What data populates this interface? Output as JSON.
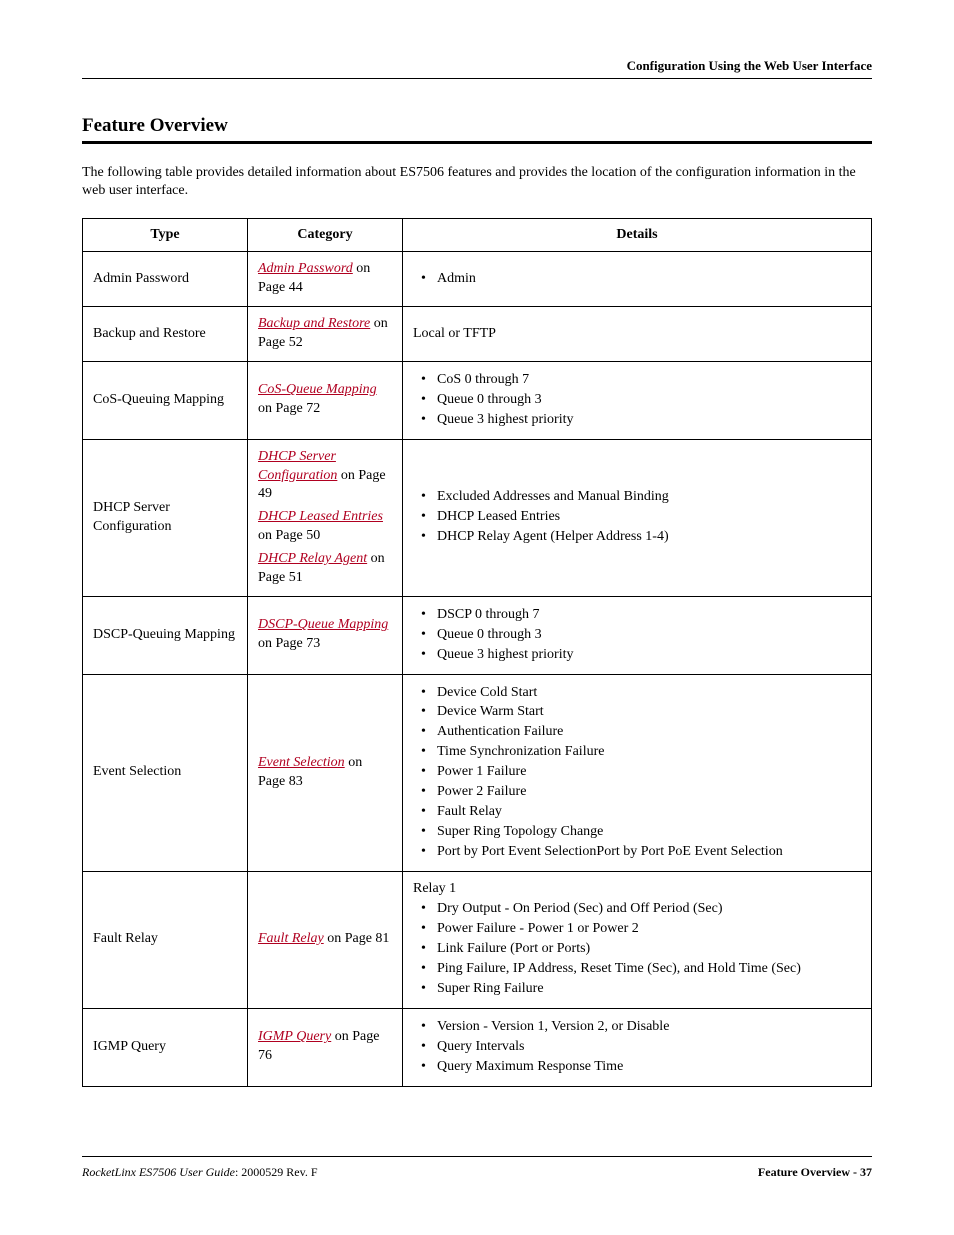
{
  "header": {
    "right": "Configuration Using the Web User Interface"
  },
  "section": {
    "title": "Feature Overview",
    "intro": "The following table provides detailed information about ES7506 features and provides the location of the configuration information in the web user interface."
  },
  "table": {
    "headers": {
      "type": "Type",
      "category": "Category",
      "details": "Details"
    },
    "rows": [
      {
        "type": "Admin Password",
        "cats": [
          {
            "link": "Admin Password",
            "suffix": " on Page 44"
          }
        ],
        "pre": "",
        "items": [
          "Admin"
        ]
      },
      {
        "type": "Backup and Restore",
        "cats": [
          {
            "link": "Backup and Restore",
            "suffix": " on Page 52"
          }
        ],
        "plain": "Local or TFTP"
      },
      {
        "type": "CoS-Queuing Mapping",
        "cats": [
          {
            "link": "CoS-Queue Mapping",
            "suffix": " on Page 72"
          }
        ],
        "items": [
          "CoS 0 through 7",
          "Queue 0 through 3",
          "Queue 3 highest priority"
        ]
      },
      {
        "type": "DHCP Server Configuration",
        "cats": [
          {
            "link": "DHCP Server Configuration",
            "suffix": " on Page 49"
          },
          {
            "link": "DHCP Leased Entries",
            "suffix": " on Page 50"
          },
          {
            "link": "DHCP Relay Agent",
            "suffix": " on Page 51"
          }
        ],
        "items": [
          "Excluded Addresses and Manual Binding",
          "DHCP Leased Entries",
          "DHCP Relay Agent (Helper Address 1-4)"
        ]
      },
      {
        "type": "DSCP-Queuing Mapping",
        "cats": [
          {
            "link": "DSCP-Queue Mapping",
            "suffix": " on Page 73"
          }
        ],
        "items": [
          "DSCP 0 through 7",
          "Queue 0 through 3",
          "Queue 3 highest priority"
        ]
      },
      {
        "type": "Event Selection",
        "cats": [
          {
            "link": "Event Selection",
            "suffix": " on Page 83"
          }
        ],
        "items": [
          "Device Cold Start",
          "Device Warm Start",
          "Authentication Failure",
          "Time Synchronization Failure",
          "Power 1 Failure",
          "Power 2 Failure",
          "Fault Relay",
          "Super Ring Topology Change",
          "Port by Port Event SelectionPort by Port PoE Event Selection"
        ]
      },
      {
        "type": "Fault Relay",
        "cats": [
          {
            "link": "Fault Relay",
            "suffix": " on Page 81"
          }
        ],
        "pre": "Relay 1",
        "items": [
          "Dry Output - On Period (Sec) and Off Period (Sec)",
          "Power Failure - Power 1 or Power 2",
          "Link Failure (Port or Ports)",
          "Ping Failure, IP Address, Reset Time (Sec), and Hold Time (Sec)",
          "Super Ring Failure"
        ]
      },
      {
        "type": "IGMP Query",
        "cats": [
          {
            "link": "IGMP Query",
            "suffix": " on Page 76"
          }
        ],
        "items": [
          "Version - Version 1, Version 2, or Disable",
          "Query Intervals",
          "Query Maximum Response Time"
        ]
      }
    ]
  },
  "footer": {
    "left_ital": "RocketLinx ES7506  User Guide",
    "left_rest": ": 2000529 Rev. F",
    "right": "Feature Overview - 37"
  }
}
